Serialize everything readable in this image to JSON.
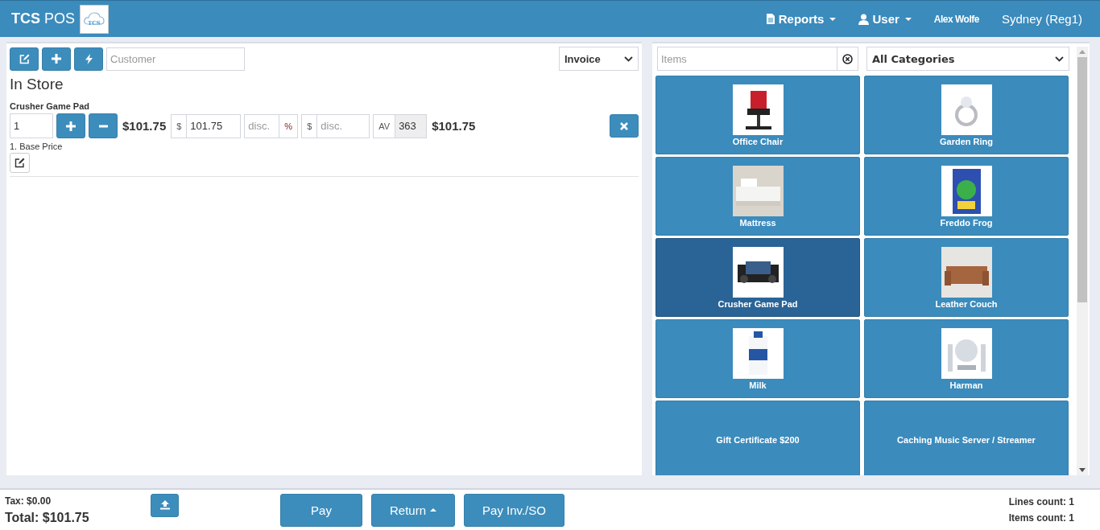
{
  "header": {
    "brand_bold": "TCS",
    "brand_rest": "POS",
    "logo_text": "TCS",
    "menu": [
      {
        "label": "Reports",
        "kind": "reports"
      },
      {
        "label": "User",
        "kind": "user"
      }
    ],
    "user_name": "Alex Wolfe",
    "register": "Sydney (Reg1)"
  },
  "order": {
    "customer_placeholder": "Customer",
    "doc_type": "Invoice",
    "location": "In Store",
    "lines": [
      {
        "name": "Crusher Game Pad",
        "qty": "1",
        "price_total": "$101.75",
        "currency": "$",
        "price": "101.75",
        "disc_placeholder": "disc.",
        "percent": "%",
        "currency2": "$",
        "disc2_placeholder": "disc.",
        "av_label": "AV",
        "av_value": "363",
        "line_total": "$101.75",
        "price_level": "1. Base Price"
      }
    ]
  },
  "catalog": {
    "search_placeholder": "Items",
    "category": "All Categories",
    "products": [
      {
        "name": "Office Chair",
        "kind": "picture",
        "selected": false
      },
      {
        "name": "Garden Ring",
        "kind": "picture",
        "selected": false
      },
      {
        "name": "Mattress",
        "kind": "picture",
        "selected": false
      },
      {
        "name": "Freddo Frog",
        "kind": "picture",
        "selected": false
      },
      {
        "name": "Crusher Game Pad",
        "kind": "picture",
        "selected": true
      },
      {
        "name": "Leather Couch",
        "kind": "picture",
        "selected": false
      },
      {
        "name": "Milk",
        "kind": "picture",
        "selected": false
      },
      {
        "name": "Harman",
        "kind": "picture",
        "selected": false
      },
      {
        "name": "Gift Certificate $200",
        "kind": "text",
        "selected": false
      },
      {
        "name": "Caching Music Server / Streamer",
        "kind": "text",
        "selected": false
      }
    ]
  },
  "footer": {
    "tax": "Tax: $0.00",
    "total": "Total: $101.75",
    "buttons": [
      {
        "label": "Pay",
        "kind": "plain"
      },
      {
        "label": "Return",
        "kind": "dropup"
      },
      {
        "label": "Pay Inv./SO",
        "kind": "plain"
      }
    ],
    "lines_count": "Lines count: 1",
    "items_count": "Items count: 1"
  }
}
